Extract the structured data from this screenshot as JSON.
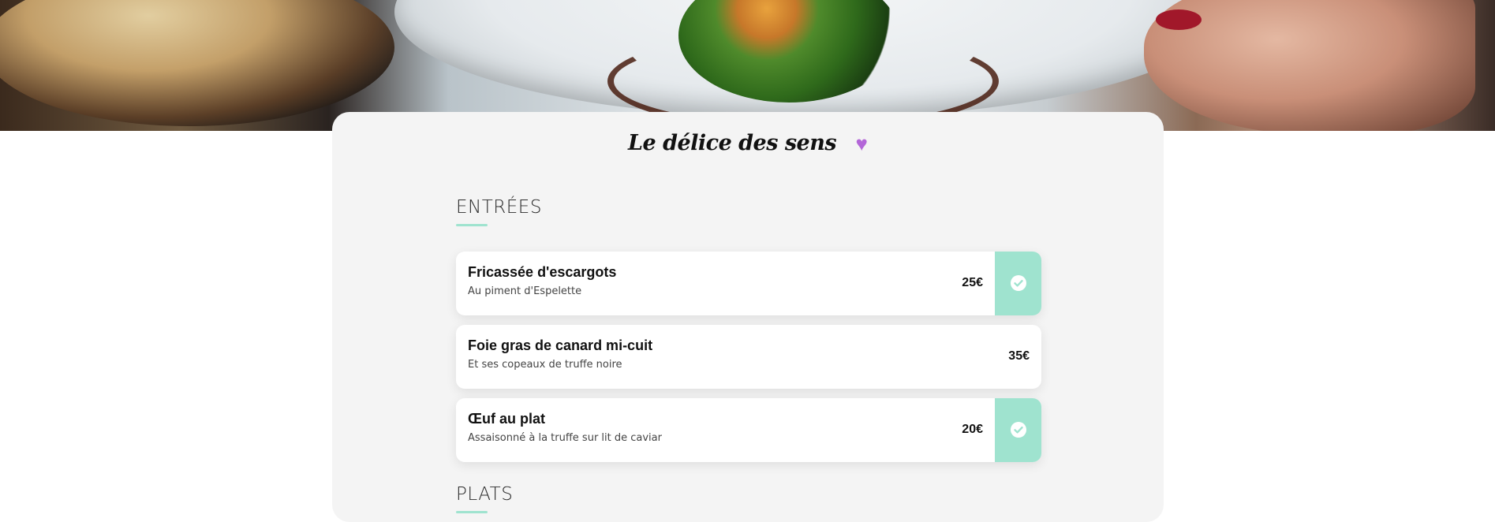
{
  "restaurant": {
    "name": "Le délice des sens",
    "heart_icon": "heart-icon",
    "heart_color": "#b366d8"
  },
  "accent_color": "#9fe3cf",
  "sections": [
    {
      "title": "ENTRÉES",
      "items": [
        {
          "name": "Fricassée d'escargots",
          "description": "Au piment d'Espelette",
          "price": "25€",
          "selected": true
        },
        {
          "name": "Foie gras de canard mi-cuit",
          "description": "Et ses copeaux de truffe noire",
          "price": "35€",
          "selected": false
        },
        {
          "name": "Œuf au plat",
          "description": "Assaisonné à la truffe sur lit de caviar",
          "price": "20€",
          "selected": true
        }
      ]
    },
    {
      "title": "PLATS",
      "items": []
    }
  ]
}
